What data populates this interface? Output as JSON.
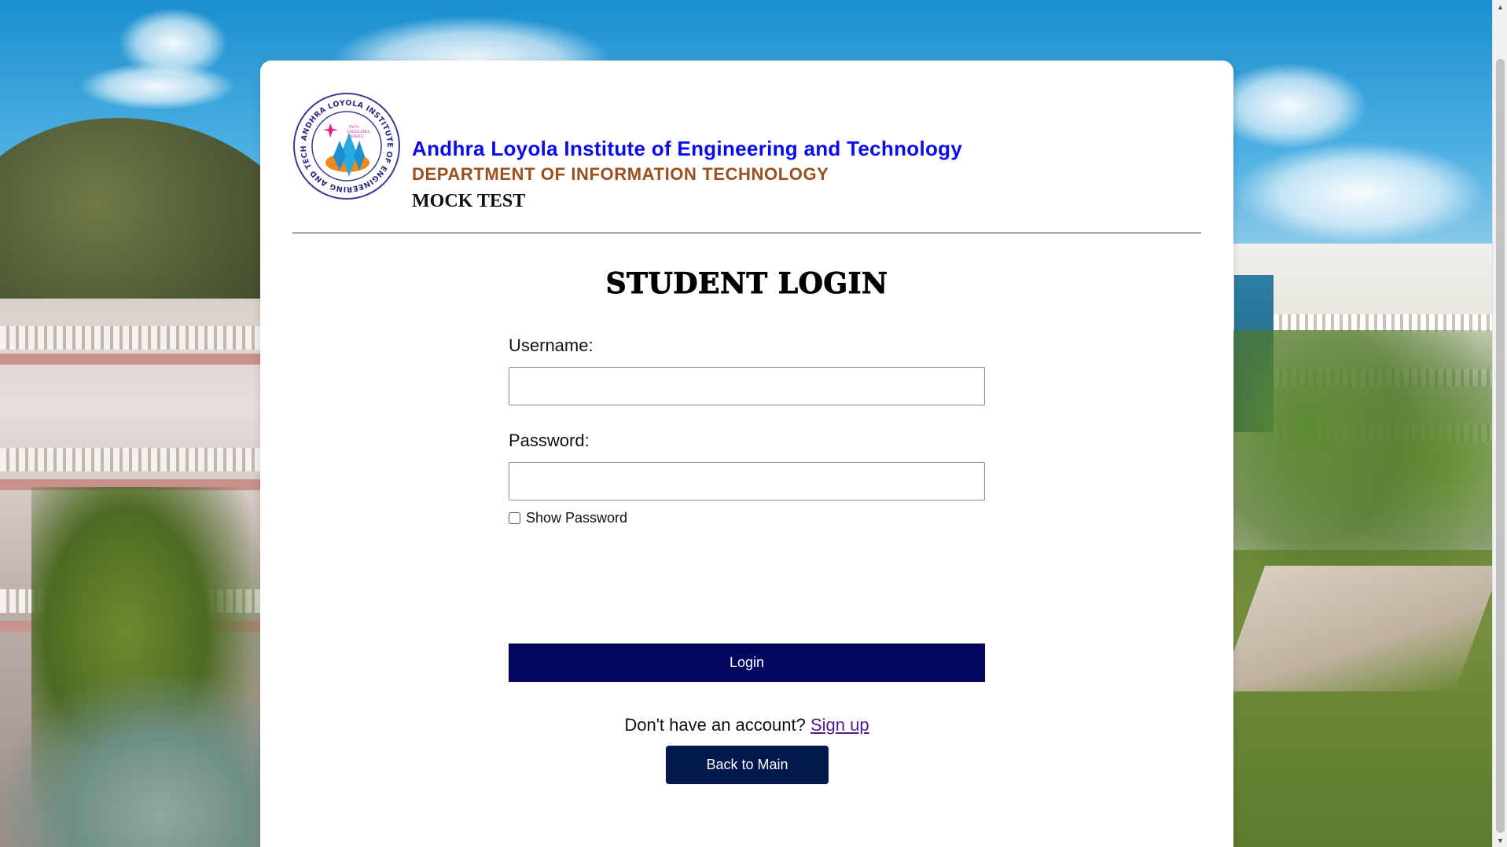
{
  "header": {
    "institution": "Andhra Loyola Institute of Engineering and Technology",
    "department": "DEPARTMENT OF INFORMATION TECHNOLOGY",
    "subtitle": "MOCK TEST",
    "logo": {
      "ring_text": "ANDHRA LOYOLA INSTITUTE OF ENGINEERING AND TECHNOLOGY",
      "motto": [
        "FAITH",
        "EXCELLENCE",
        "SERVICE"
      ]
    }
  },
  "login": {
    "title": "STUDENT LOGIN",
    "username_label": "Username:",
    "username_value": "",
    "password_label": "Password:",
    "password_value": "",
    "show_password_label": "Show Password",
    "show_password_checked": false,
    "login_button": "Login",
    "signup_prompt": "Don't have an account?",
    "signup_link": "Sign up",
    "back_button": "Back to Main"
  },
  "colors": {
    "institution_text": "#0a0af0",
    "department_text": "#9a4f1e",
    "login_button_bg": "#05075f",
    "back_button_bg": "#03184a",
    "link": "#551a8b"
  },
  "icons": {
    "scroll_up": "scroll-up-arrow-icon",
    "scroll_down": "scroll-down-arrow-icon"
  }
}
